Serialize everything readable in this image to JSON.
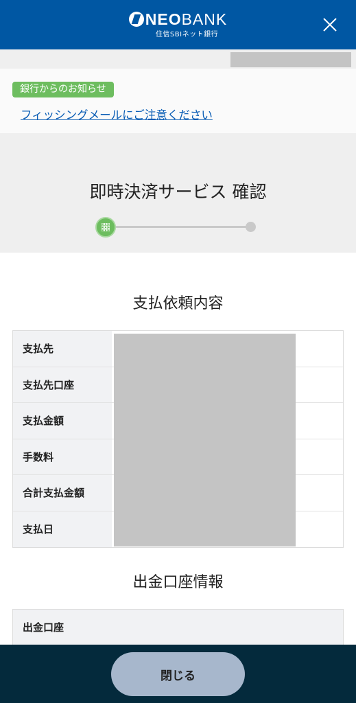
{
  "header": {
    "logo_bold": "NEO",
    "logo_thin": "BANK",
    "logo_sub": "住信SBIネット銀行",
    "close_icon": "close-icon"
  },
  "notice": {
    "badge": "銀行からのお知らせ",
    "link": "フィッシングメールにご注意ください"
  },
  "page": {
    "title": "即時決済サービス 確認",
    "step_icon": "grid-icon",
    "total_steps": 2,
    "current_step": 1
  },
  "payment_details": {
    "title": "支払依頼内容",
    "rows": [
      {
        "label": "支払先"
      },
      {
        "label": "支払先口座"
      },
      {
        "label": "支払金額"
      },
      {
        "label": "手数料"
      },
      {
        "label": "合計支払金額"
      },
      {
        "label": "支払日"
      }
    ]
  },
  "withdrawal": {
    "title": "出金口座情報",
    "label": "出金口座"
  },
  "footer": {
    "close_label": "閉じる"
  },
  "colors": {
    "brand": "#0057a3",
    "accent_green": "#6dbd5f",
    "link": "#0a5db5",
    "footer": "#042a3c",
    "button": "#a7b7cc"
  }
}
